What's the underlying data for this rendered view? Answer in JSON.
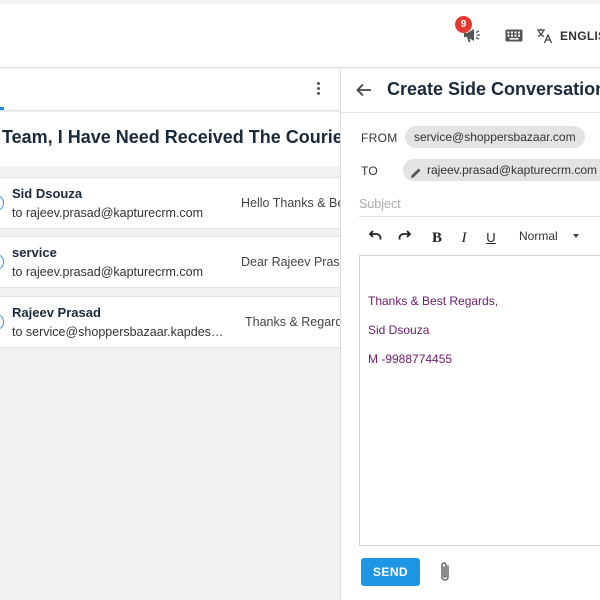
{
  "topbar": {
    "notification_count": "9",
    "language_label": "ENGLISH"
  },
  "left_panel": {
    "subject": "Team, I Have Need Received The Courier",
    "conversations": [
      {
        "name": "Sid Dsouza",
        "to": "to rajeev.prasad@kapturecrm.com",
        "preview": "Hello Thanks & Best Regards"
      },
      {
        "name": "service",
        "to": "to rajeev.prasad@kapturecrm.com",
        "preview": "Dear Rajeev Prasad"
      },
      {
        "name": "Rajeev Prasad",
        "to": "to service@shoppersbazaar.kapdesk.com",
        "preview": "Thanks & Regards"
      }
    ]
  },
  "side_conversation": {
    "title": "Create Side Conversation",
    "from_label": "FROM",
    "from_value": "service@shoppersbazaar.com",
    "to_label": "TO",
    "to_value": "rajeev.prasad@kapturecrm.com",
    "subject_placeholder": "Subject",
    "format_select": "Normal",
    "body_lines": [
      "Thanks & Best Regards,",
      "Sid Dsouza",
      "M -9988774455"
    ],
    "send_label": "SEND"
  },
  "icons": {
    "notification": "megaphone-icon",
    "keyboard": "keyboard-icon",
    "language": "translate-icon",
    "back": "arrow-left-icon",
    "attach": "paperclip-icon",
    "edit": "pencil-icon"
  },
  "colors": {
    "accent": "#1e96e6",
    "badge": "#e53935",
    "signature": "#6a1b6a"
  }
}
